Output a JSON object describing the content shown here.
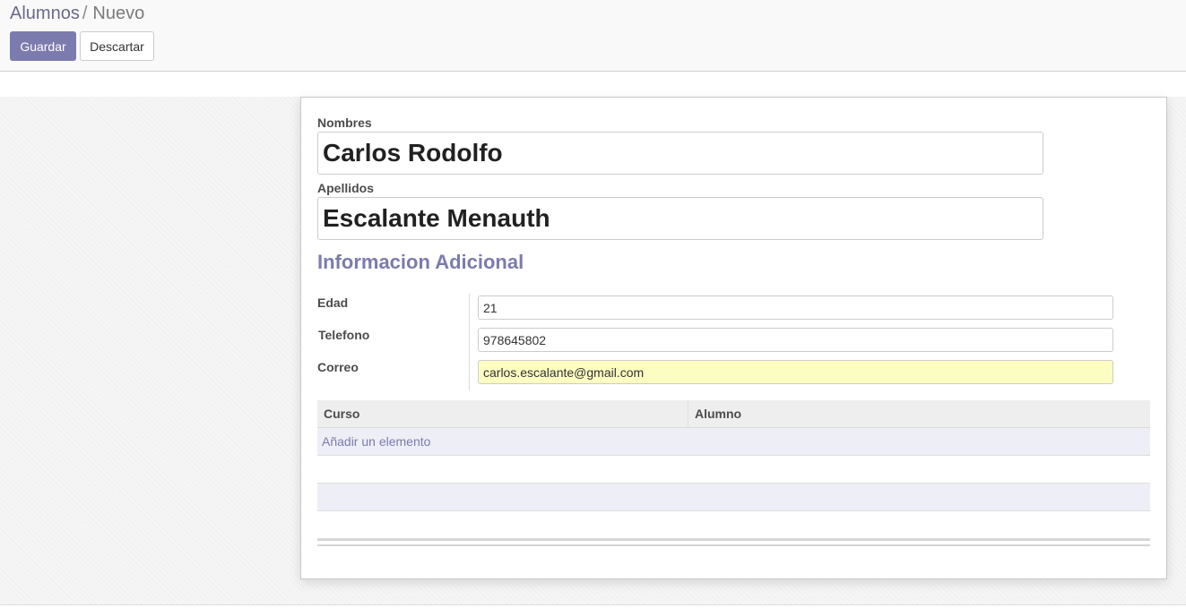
{
  "breadcrumb": {
    "parent": "Alumnos",
    "separator": "/",
    "current": "Nuevo"
  },
  "toolbar": {
    "save_label": "Guardar",
    "discard_label": "Descartar"
  },
  "form": {
    "nombres": {
      "label": "Nombres",
      "value": "Carlos Rodolfo"
    },
    "apellidos": {
      "label": "Apellidos",
      "value": "Escalante Menauth"
    },
    "section_title": "Informacion Adicional",
    "edad": {
      "label": "Edad",
      "value": "21"
    },
    "telefono": {
      "label": "Telefono",
      "value": "978645802"
    },
    "correo": {
      "label": "Correo",
      "value": "carlos.escalante@gmail.com"
    }
  },
  "table": {
    "columns": [
      "Curso",
      "Alumno"
    ],
    "add_line_label": "Añadir un elemento"
  },
  "colors": {
    "brand": "#7c7bad",
    "required_field": "#fbfdc1"
  }
}
